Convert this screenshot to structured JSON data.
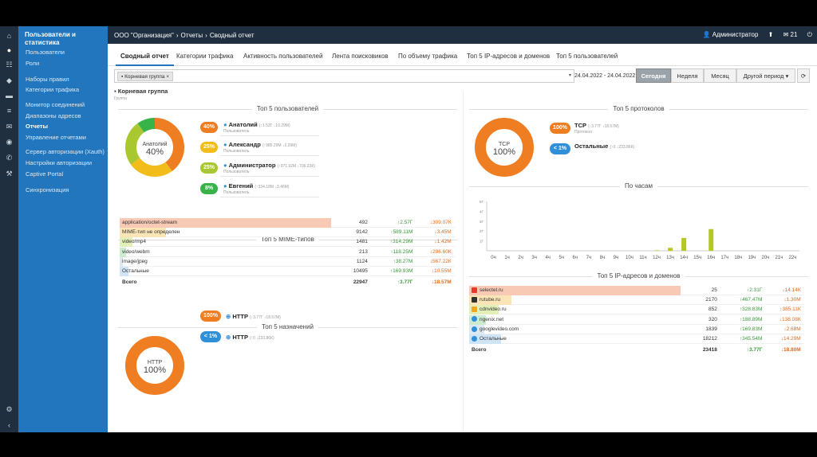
{
  "topbar": {
    "breadcrumb": [
      "ООО \"Организация\"",
      "Отчеты",
      "Сводный отчет"
    ],
    "user": "Администратор",
    "messages": "21"
  },
  "iconbar": [
    "home-icon",
    "user-icon",
    "network-icon",
    "shield-icon",
    "folder-icon",
    "list-icon",
    "mail-icon",
    "location-icon",
    "phone-icon",
    "wrench-icon",
    "gear-icon",
    "arrow-left-icon"
  ],
  "sidebar": {
    "title": "Пользователи и статистика",
    "items": [
      "Пользователи",
      "Роли",
      "Наборы правил",
      "Категории трафика",
      "Монитор соединений",
      "Диапазоны адресов",
      "Отчеты",
      "Управление отчетами",
      "Сервер авторизации (Xauth)",
      "Настройки авторизации",
      "Captive Portal",
      "Синхронизация"
    ]
  },
  "tabs": [
    "Сводный отчет",
    "Категории трафика",
    "Активность пользователей",
    "Лента поисковиков",
    "По объему трафика",
    "Топ 5 IP-адресов и доменов",
    "Топ 5 пользователей"
  ],
  "filter": {
    "chip": "Корневая группа",
    "dropdown": "▾"
  },
  "period": {
    "range": "24.04.2022 - 24.04.2022",
    "buttons": [
      "Сегодня",
      "Неделя",
      "Месяц",
      "Другой период"
    ],
    "refresh": "⟳"
  },
  "group": {
    "name": "Корневая группа",
    "sub": "Группа"
  },
  "top_users": {
    "title": "Топ 5 пользователей",
    "center_name": "Анатолий",
    "center_pct": "40%",
    "users": [
      {
        "pct": "40%",
        "name": "Анатолий",
        "stat": "(↑1.53Г ↓10.29М)",
        "sub": "Пользователь",
        "color": "#ef7d22"
      },
      {
        "pct": "25%",
        "name": "Александр",
        "stat": "(↑985.29М ↓2.29М)",
        "sub": "Пользователь",
        "color": "#f2bc1b"
      },
      {
        "pct": "25%",
        "name": "Администратор",
        "stat": "(↑971.92М ↓706.23К)",
        "sub": "Пользователь",
        "color": "#a9c82f"
      },
      {
        "pct": "8%",
        "name": "Евгений",
        "stat": "(↑334.18М ↓3.46М)",
        "sub": "Пользователь",
        "color": "#38b34a"
      }
    ]
  },
  "top_protocols": {
    "title": "Топ 5 протоколов",
    "center_name": "TCP",
    "center_pct": "100%",
    "items": [
      {
        "pct": "100%",
        "name": "TCP",
        "stat": "(↑3.77Г ↓18.57М)",
        "sub": "Протокол",
        "color": "#ef7d22"
      },
      {
        "pct": "< 1%",
        "name": "Остальные",
        "stat": "(↑0 ↓233.86К)",
        "sub": "",
        "color": "#2f8fd8"
      }
    ]
  },
  "mime": {
    "title": "Топ 5 MIME-типов",
    "rows": [
      {
        "label": "application/octet-stream",
        "count": "492",
        "up": "↑2.57Г",
        "down": "↓309.07К",
        "color": "#f8c9b4",
        "frac": 1.0
      },
      {
        "label": "MIME-тип не определен",
        "count": "9142",
        "up": "↑589.11М",
        "down": "↓3.45М",
        "color": "#fbe4b6",
        "frac": 0.22
      },
      {
        "label": "video/mp4",
        "count": "1481",
        "up": "↑314.29М",
        "down": "↓1.42М",
        "color": "#e3efb8",
        "frac": 0.06
      },
      {
        "label": "video/webm",
        "count": "213",
        "up": "↑118.25М",
        "down": "↓296.60К",
        "color": "#cdeccf",
        "frac": 0.03
      },
      {
        "label": "image/jpeg",
        "count": "1124",
        "up": "↑38.27М",
        "down": "↓567.22К",
        "color": "#dde8f2",
        "frac": 0.01
      },
      {
        "label": "Остальные",
        "count": "10495",
        "up": "↑169.93М",
        "down": "↓10.55М",
        "color": "#cfe4f5",
        "frac": 0.04
      }
    ],
    "total": {
      "label": "Всего",
      "count": "22947",
      "up": "↑3.77Г",
      "down": "↓18.57М"
    }
  },
  "destinations": {
    "title": "Топ 5 назначений",
    "center_name": "HTTP",
    "center_pct": "100%",
    "items": [
      {
        "pct": "100%",
        "name": "HTTP",
        "stat": "(↑3.77Г ↓18.57М)",
        "color": "#ef7d22"
      },
      {
        "pct": "< 1%",
        "name": "HTTP",
        "stat": "(↑0 ↓233.86К)",
        "color": "#2f8fd8"
      }
    ]
  },
  "hours": {
    "title": "По часам",
    "categories": [
      "0ч",
      "1ч",
      "2ч",
      "3ч",
      "4ч",
      "5ч",
      "6ч",
      "7ч",
      "8ч",
      "9ч",
      "10ч",
      "11ч",
      "12ч",
      "13ч",
      "14ч",
      "15ч",
      "16ч",
      "17ч",
      "18ч",
      "19ч",
      "20ч",
      "21ч",
      "22ч"
    ],
    "y_ticks": [
      "5Г",
      "4Г",
      "3Г",
      "2Г",
      "1Г"
    ]
  },
  "chart_data": {
    "type": "bar",
    "title": "По часам",
    "categories": [
      "0ч",
      "1ч",
      "2ч",
      "3ч",
      "4ч",
      "5ч",
      "6ч",
      "7ч",
      "8ч",
      "9ч",
      "10ч",
      "11ч",
      "12ч",
      "13ч",
      "14ч",
      "15ч",
      "16ч",
      "17ч",
      "18ч",
      "19ч",
      "20ч",
      "21ч",
      "22ч"
    ],
    "values": [
      0,
      0,
      0,
      0,
      0,
      0,
      0,
      0,
      0,
      0,
      0,
      0,
      0.05,
      0.3,
      1.3,
      0,
      2.2,
      0,
      0,
      0,
      0,
      0,
      0
    ],
    "ylim": [
      0,
      5
    ],
    "color": "#b5c820"
  },
  "ip_domains": {
    "title": "Топ 5 IP-адресов и доменов",
    "rows": [
      {
        "icon": "selectel-icon",
        "label": "selectel.ru",
        "count": "25",
        "up": "↑2.31Г",
        "down": "↓14.14К",
        "color": "#f8c9b4",
        "frac": 1.0,
        "ic": "#e53b2f"
      },
      {
        "icon": "rutube-icon",
        "label": "rutube.ru",
        "count": "2170",
        "up": "↑467.47М",
        "down": "↓1.30М",
        "color": "#fbe4b6",
        "frac": 0.2,
        "ic": "#333"
      },
      {
        "icon": "cdnvideo-icon",
        "label": "cdnvideo.ru",
        "count": "852",
        "up": "↑328.83М",
        "down": "↓385.11К",
        "color": "#e3efb8",
        "frac": 0.14,
        "ic": "#f2a61b"
      },
      {
        "icon": "ngenix-icon",
        "label": "ngenix.net",
        "count": "320",
        "up": "↑188.89М",
        "down": "↓136.08К",
        "color": "#cdeccf",
        "frac": 0.08,
        "ic": "#2f8fd8"
      },
      {
        "icon": "googlevideo-icon",
        "label": "googlevideo.com",
        "count": "1839",
        "up": "↑169.83М",
        "down": "↓2.68М",
        "color": "#dde8f2",
        "frac": 0.07,
        "ic": "#2f8fd8"
      },
      {
        "icon": "other-icon",
        "label": "Остальные",
        "count": "18212",
        "up": "↑345.54М",
        "down": "↓14.29М",
        "color": "#cfe4f5",
        "frac": 0.15,
        "ic": "#2f8fd8"
      }
    ],
    "total": {
      "label": "Всего",
      "count": "23418",
      "up": "↑3.77Г",
      "down": "↓18.80М"
    }
  }
}
